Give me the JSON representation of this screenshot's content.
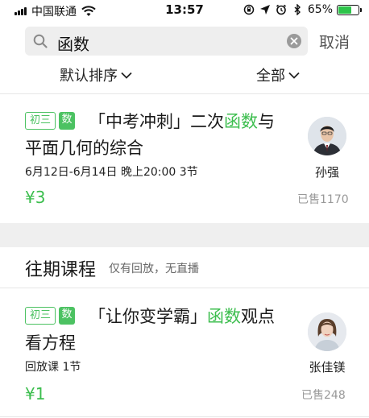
{
  "status_bar": {
    "carrier": "中国联通",
    "time": "13:57",
    "battery_percent": "65%",
    "battery_level": 0.65,
    "icons": [
      "signal-icon",
      "wifi-icon",
      "orientation-lock-icon",
      "location-icon",
      "alarm-icon",
      "bluetooth-icon",
      "battery-icon"
    ]
  },
  "search": {
    "query": "函数",
    "cancel_label": "取消"
  },
  "filters": {
    "sort_label": "默认排序",
    "scope_label": "全部"
  },
  "courses": [
    {
      "grade_tag": "初三",
      "subject_tag": "数",
      "title_line1_pre": "「中考冲刺」二次",
      "title_line1_hl": "函数",
      "title_line1_post": "与",
      "title_line2": "平面几何的综合",
      "meta": "6月12日-6月14日 晚上20:00  3节",
      "price": "¥3",
      "sold": "已售1170",
      "teacher": "孙强"
    },
    {
      "grade_tag": "初三",
      "subject_tag": "数",
      "title_line1_pre": "「让你变学霸」",
      "title_line1_hl": "函数",
      "title_line1_post": "观点",
      "title_line2": "看方程",
      "meta": "回放课 1节",
      "price": "¥1",
      "sold": "已售248",
      "teacher": "张佳镁"
    }
  ],
  "past_section": {
    "title": "往期课程",
    "subtitle": "仅有回放，无直播"
  },
  "colors": {
    "accent_green": "#3cbe4e",
    "band_gray": "#efefef"
  }
}
